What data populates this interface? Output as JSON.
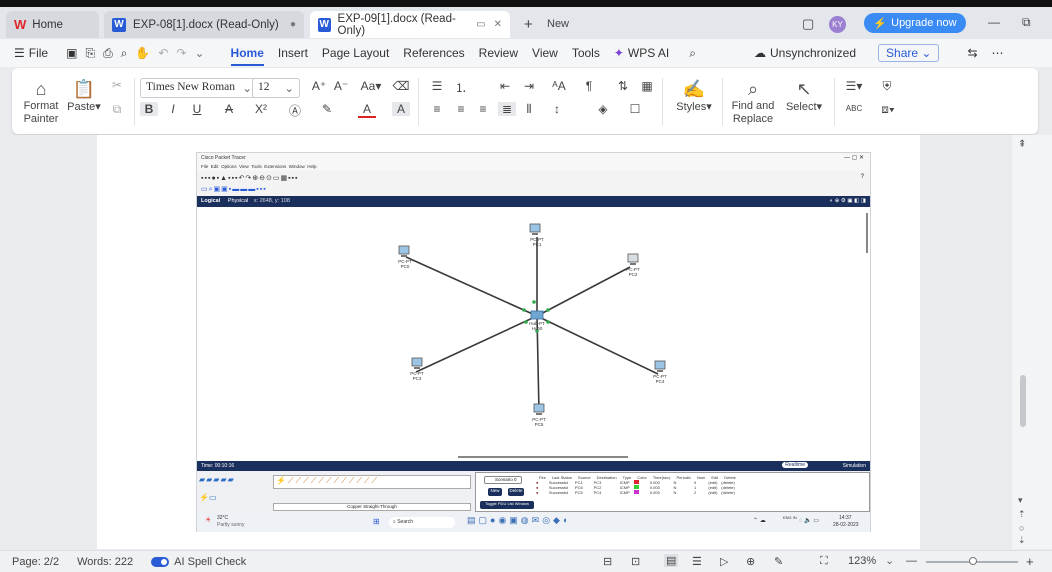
{
  "tabs": [
    {
      "label": "Home",
      "state": "inactive"
    },
    {
      "label": "EXP-08[1].docx (Read-Only)",
      "state": "inactive"
    },
    {
      "label": "EXP-09[1].docx (Read-Only)",
      "state": "active"
    }
  ],
  "tab_new_label": "New",
  "upgrade_label": "Upgrade now",
  "avatar_initials": "KY",
  "menu": {
    "file": "File",
    "items": [
      "Home",
      "Insert",
      "Page Layout",
      "References",
      "Review",
      "View",
      "Tools"
    ],
    "wps_ai": "WPS AI",
    "sync_status": "Unsynchronized",
    "share": "Share"
  },
  "ribbon": {
    "format_painter_line1": "Format",
    "format_painter_line2": "Painter",
    "paste": "Paste",
    "font_name": "Times New Roman",
    "font_size": "12",
    "styles": "Styles",
    "find_replace_line1": "Find and",
    "find_replace_line2": "Replace",
    "select": "Select",
    "abc_label": "ABC",
    "bold": "B",
    "italic": "I",
    "underline": "U"
  },
  "embedded_screenshot": {
    "title": "Cisco Packet Tracer",
    "menu": [
      "File",
      "Edit",
      "Options",
      "View",
      "Tools",
      "Extensions",
      "Window",
      "Help"
    ],
    "logical_tab": "Logical",
    "physical_tab": "Physical",
    "coords": "x: 2648, y: 108",
    "devices": [
      {
        "line1": "PC-PT",
        "line2": "PC0"
      },
      {
        "line1": "PC-PT",
        "line2": "PC1"
      },
      {
        "line1": "PC-PT",
        "line2": "PC2"
      },
      {
        "line1": "PC-PT",
        "line2": "PC3"
      },
      {
        "line1": "PC-PT",
        "line2": "PC4"
      },
      {
        "line1": "PC-PT",
        "line2": "PC5"
      }
    ],
    "hub": {
      "line1": "Hub-PT",
      "line2": "Hub0"
    },
    "time": "Time: 00:10:16",
    "realtime": "Realtime",
    "simulation": "Simulation",
    "cable_label": "Copper Straight-Through",
    "scenario": "Scenario 0",
    "new_btn": "New",
    "delete_btn": "Delete",
    "toggle_btn": "Toggle PDU List Window",
    "pdu_headers": [
      "Fire",
      "Last Status",
      "Source",
      "Destination",
      "Type",
      "Color",
      "Time(sec)",
      "Periodic",
      "Num",
      "Edit",
      "Delete"
    ],
    "pdu_rows": [
      [
        "",
        "Successful",
        "PC1",
        "PC3",
        "ICMP",
        "",
        "0.000",
        "N",
        "0",
        "(edit)",
        "(delete)"
      ],
      [
        "",
        "Successful",
        "PC6",
        "PC2",
        "ICMP",
        "",
        "0.000",
        "N",
        "1",
        "(edit)",
        "(delete)"
      ],
      [
        "",
        "Successful",
        "PC5",
        "PC4",
        "ICMP",
        "",
        "0.000",
        "N",
        "2",
        "(edit)",
        "(delete)"
      ]
    ],
    "weather": "32°C",
    "weather_sub": "Partly sunny",
    "search": "Search",
    "lang": "ENG IN",
    "clock_time": "14:37",
    "clock_date": "28-02-2023"
  },
  "status": {
    "page": "Page: 2/2",
    "words": "Words: 222",
    "spell": "AI Spell Check",
    "zoom": "123%"
  },
  "colors": {
    "accent": "#2a5bd7",
    "upgrade_bg": "#3b8bf5",
    "pt_bar": "#1b2f5c",
    "link_green": "#2fa84f"
  }
}
